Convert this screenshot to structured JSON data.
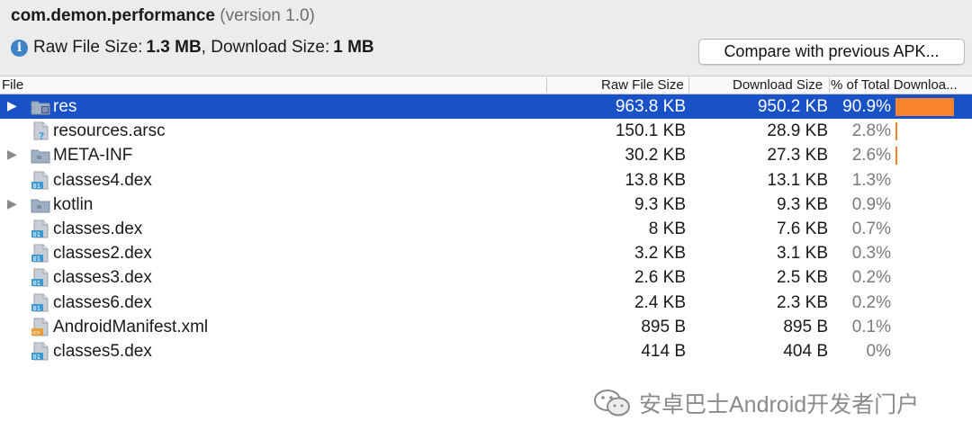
{
  "header": {
    "package": "com.demon.performance",
    "version": "(version 1.0)",
    "raw_label": "Raw File Size: ",
    "raw_value": "1.3 MB",
    "dl_label": ", Download Size: ",
    "dl_value": "1 MB",
    "compare_button": "Compare with previous APK..."
  },
  "columns": {
    "file": "File",
    "raw": "Raw File Size",
    "download": "Download Size",
    "percent": "% of Total Downloa..."
  },
  "rows": [
    {
      "name": "res",
      "raw": "963.8 KB",
      "dl": "950.2 KB",
      "pct": "90.9%",
      "expandable": true,
      "icon": "folder-res-icon",
      "bar": 0.909
    },
    {
      "name": "resources.arsc",
      "raw": "150.1 KB",
      "dl": "28.9 KB",
      "pct": "2.8%",
      "expandable": false,
      "icon": "unknown-file-icon",
      "bar": 0.028
    },
    {
      "name": "META-INF",
      "raw": "30.2 KB",
      "dl": "27.3 KB",
      "pct": "2.6%",
      "expandable": true,
      "icon": "folder-icon",
      "bar": 0.026
    },
    {
      "name": "classes4.dex",
      "raw": "13.8 KB",
      "dl": "13.1 KB",
      "pct": "1.3%",
      "expandable": false,
      "icon": "dex-file-icon",
      "bar": 0
    },
    {
      "name": "kotlin",
      "raw": "9.3 KB",
      "dl": "9.3 KB",
      "pct": "0.9%",
      "expandable": true,
      "icon": "folder-icon",
      "bar": 0
    },
    {
      "name": "classes.dex",
      "raw": "8 KB",
      "dl": "7.6 KB",
      "pct": "0.7%",
      "expandable": false,
      "icon": "dex-file-icon",
      "bar": 0
    },
    {
      "name": "classes2.dex",
      "raw": "3.2 KB",
      "dl": "3.1 KB",
      "pct": "0.3%",
      "expandable": false,
      "icon": "dex-file-icon",
      "bar": 0
    },
    {
      "name": "classes3.dex",
      "raw": "2.6 KB",
      "dl": "2.5 KB",
      "pct": "0.2%",
      "expandable": false,
      "icon": "dex-file-icon",
      "bar": 0
    },
    {
      "name": "classes6.dex",
      "raw": "2.4 KB",
      "dl": "2.3 KB",
      "pct": "0.2%",
      "expandable": false,
      "icon": "dex-file-icon",
      "bar": 0
    },
    {
      "name": "AndroidManifest.xml",
      "raw": "895 B",
      "dl": "895 B",
      "pct": "0.1%",
      "expandable": false,
      "icon": "xml-file-icon",
      "bar": 0
    },
    {
      "name": "classes5.dex",
      "raw": "414 B",
      "dl": "404 B",
      "pct": "0%",
      "expandable": false,
      "icon": "dex-file-icon",
      "bar": 0
    }
  ],
  "selected_row": 0,
  "watermark": "安卓巴士Android开发者门户",
  "colors": {
    "selection": "#1951c6",
    "bar": "#f7832d",
    "info": "#3d83c5"
  }
}
